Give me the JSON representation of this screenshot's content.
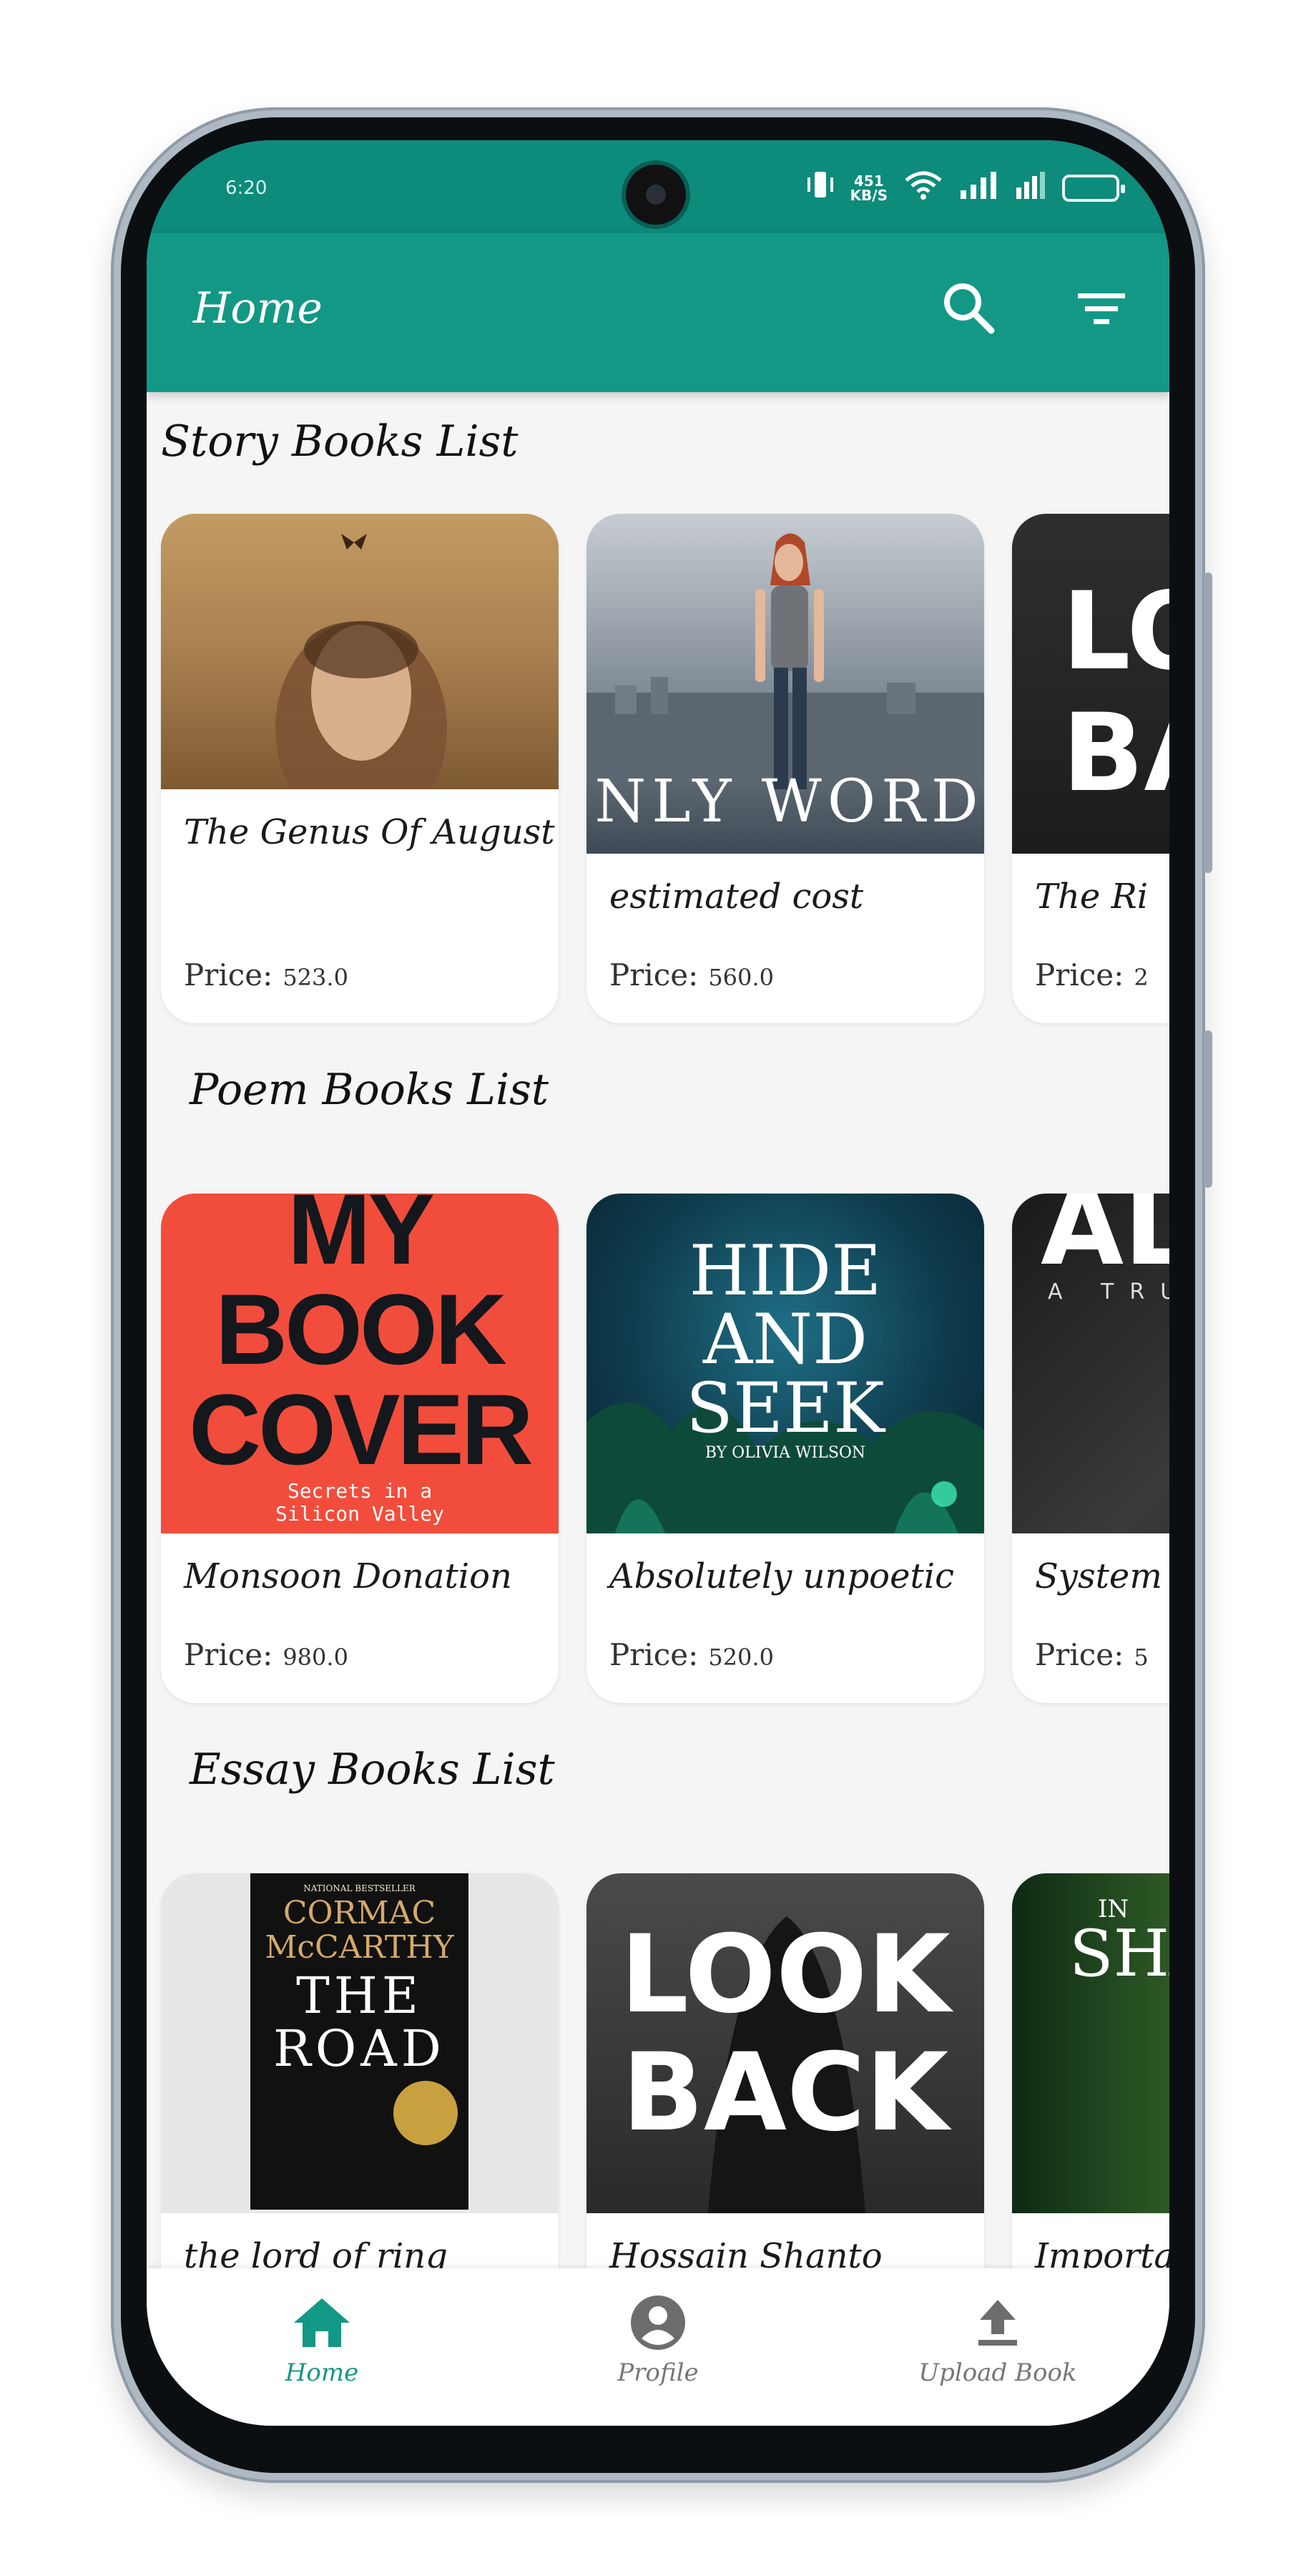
{
  "status": {
    "time": "6:20",
    "net_speed_value": "451",
    "net_speed_unit": "KB/S"
  },
  "appbar": {
    "title": "Home",
    "search_icon": "search-icon",
    "filter_icon": "filter-icon",
    "accent": "#139886"
  },
  "sections": [
    {
      "title": "Story Books List",
      "books": [
        {
          "name": "The Genus Of August",
          "price_label": "Price:",
          "price": "523.0"
        },
        {
          "name": "estimated cost",
          "price_label": "Price:",
          "price": "560.0"
        },
        {
          "name": "The Ri",
          "price_label": "Price:",
          "price": "2"
        }
      ]
    },
    {
      "title": "Poem Books List",
      "books": [
        {
          "name": "Monsoon Donation",
          "price_label": "Price:",
          "price": "980.0"
        },
        {
          "name": "Absolutely unpoetic",
          "price_label": "Price:",
          "price": "520.0"
        },
        {
          "name": "System",
          "price_label": "Price:",
          "price": "5"
        }
      ]
    },
    {
      "title": "Essay Books List",
      "books": [
        {
          "name": "the lord of ring"
        },
        {
          "name": "Hossain Shanto"
        },
        {
          "name": "Importa"
        }
      ]
    }
  ],
  "covers": {
    "only_words": "ONLY WORDS",
    "lo_ba": [
      "LO",
      "BA"
    ],
    "my_book_cover": [
      "MY",
      "BOOK",
      "COVER"
    ],
    "my_book_cover_sub": [
      "Secrets in a",
      "Silicon Valley"
    ],
    "hide_and_seek": [
      "HIDE",
      "AND",
      "SEEK"
    ],
    "hide_and_seek_author": "BY OLIVIA WILSON",
    "al": "AL",
    "al_sub": "A TRU",
    "road_top": "NATIONAL BESTSELLER",
    "road_author": [
      "CORMAC",
      "McCARTHY"
    ],
    "road_title": [
      "THE",
      "ROAD"
    ],
    "look_back": [
      "LOOK",
      "BACK"
    ],
    "in_sha": [
      "IN",
      "SHA"
    ]
  },
  "bottom_nav": [
    {
      "label": "Home",
      "icon": "home-icon",
      "active": true
    },
    {
      "label": "Profile",
      "icon": "profile-icon",
      "active": false
    },
    {
      "label": "Upload Book",
      "icon": "upload-icon",
      "active": false
    }
  ]
}
